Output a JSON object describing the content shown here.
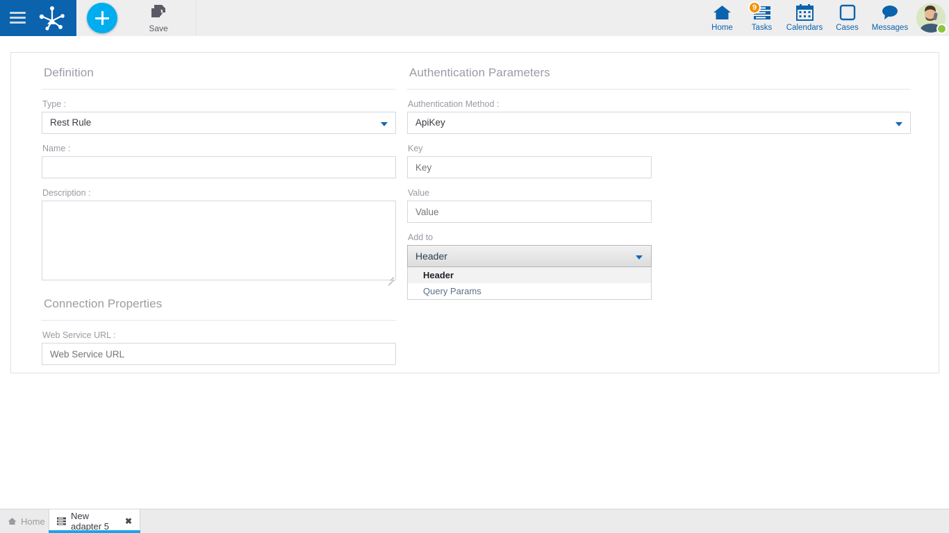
{
  "topbar": {
    "menu_icon": "hamburger-menu-icon",
    "logo_icon": "node-graph-logo-icon",
    "add_icon": "plus-icon",
    "save": {
      "label": "Save",
      "icon": "floppy-save-icon"
    },
    "nav": [
      {
        "label": "Home",
        "icon": "home-icon",
        "badge": ""
      },
      {
        "label": "Tasks",
        "icon": "tasks-list-icon",
        "badge": "9"
      },
      {
        "label": "Calendars",
        "icon": "calendar-icon",
        "badge": ""
      },
      {
        "label": "Cases",
        "icon": "case-square-icon",
        "badge": ""
      },
      {
        "label": "Messages",
        "icon": "speech-bubble-icon",
        "badge": ""
      }
    ],
    "avatar": {
      "icon": "user-avatar",
      "status": "online"
    }
  },
  "definition": {
    "title": "Definition",
    "type_label": "Type :",
    "type_value": "Rest Rule",
    "name_label": "Name :",
    "name_value": "",
    "description_label": "Description :",
    "description_value": ""
  },
  "connection": {
    "title": "Connection Properties",
    "url_label": "Web Service URL :",
    "url_placeholder": "Web Service URL",
    "url_value": ""
  },
  "auth": {
    "title": "Authentication Parameters",
    "method_label": "Authentication Method :",
    "method_value": "ApiKey",
    "key_label": "Key",
    "key_placeholder": "Key",
    "key_value": "",
    "value_label": "Value",
    "value_placeholder": "Value",
    "value_value": "",
    "addto_label": "Add to",
    "addto_value": "Header",
    "addto_options": [
      {
        "label": "Header",
        "selected": true
      },
      {
        "label": "Query Params",
        "selected": false
      }
    ]
  },
  "taskbar": {
    "tabs": [
      {
        "label": "Home",
        "icon": "home-small-icon",
        "active": false
      },
      {
        "label": "New adapter 5",
        "icon": "adapter-icon",
        "active": true,
        "close": "✖"
      }
    ]
  },
  "colors": {
    "brand_blue": "#0b63ad",
    "accent_cyan": "#00aeef",
    "badge_orange": "#f29100",
    "status_green": "#8cc63e",
    "tab_underline": "#18a5e8"
  }
}
